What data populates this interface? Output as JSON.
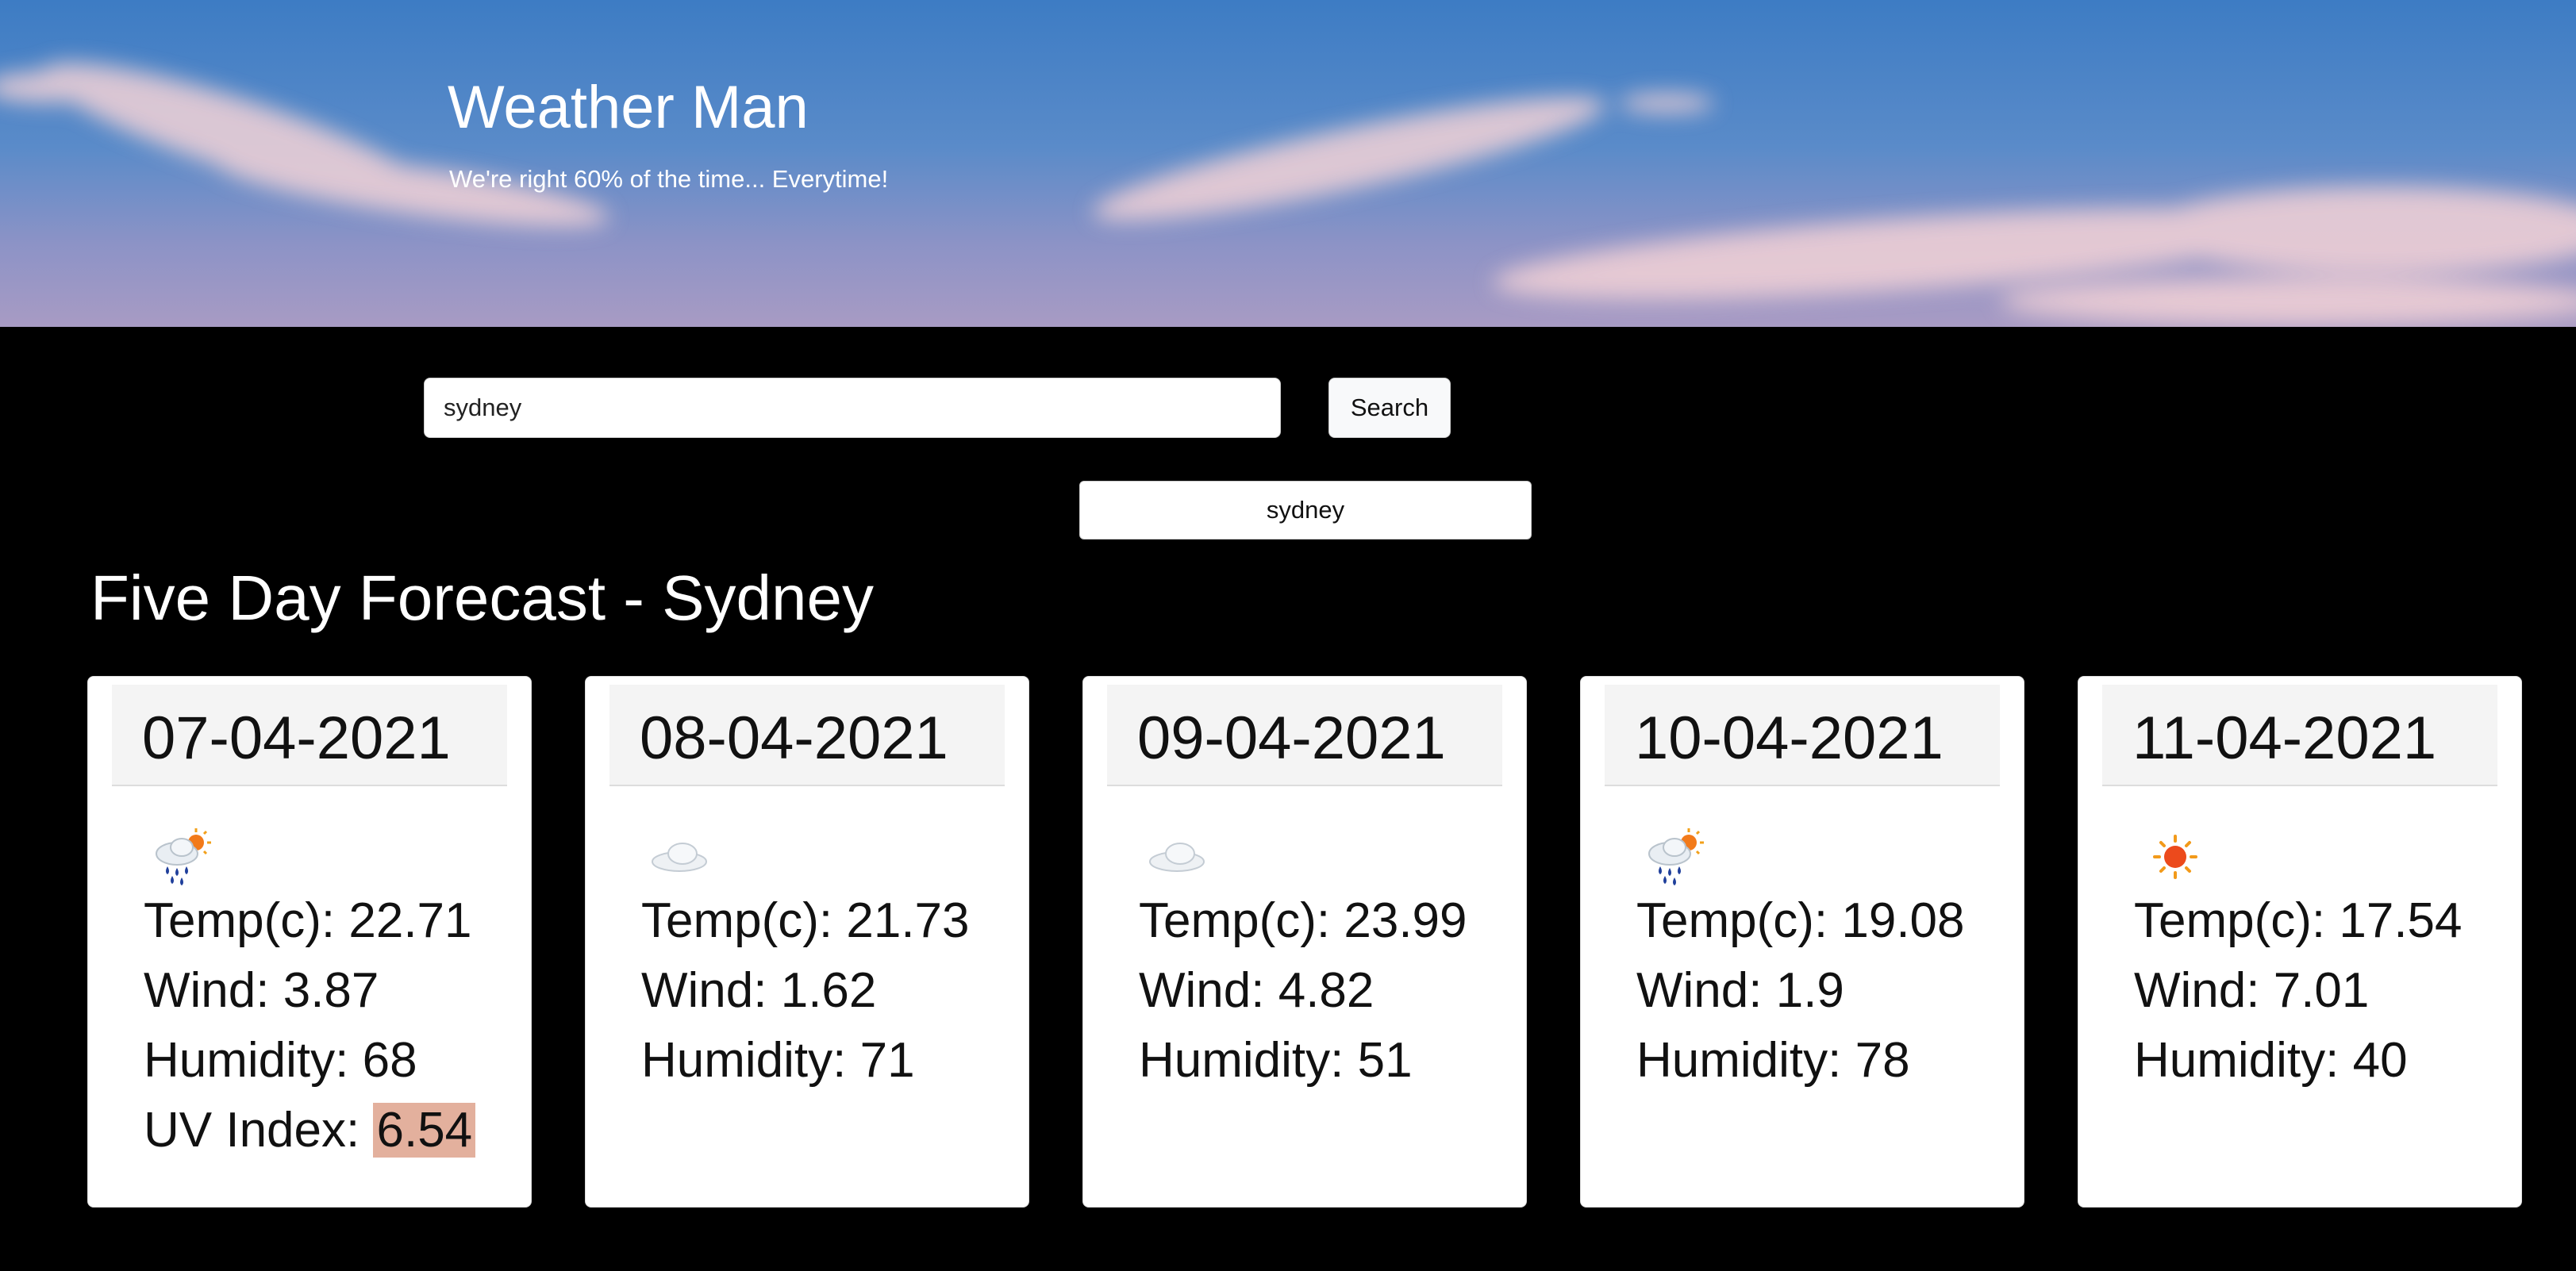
{
  "header": {
    "title": "Weather Man",
    "subtitle": "We're right 60% of the time... Everytime!"
  },
  "search": {
    "value": "sydney",
    "button_label": "Search"
  },
  "history": {
    "items": [
      "sydney"
    ]
  },
  "forecast": {
    "heading": "Five Day Forecast - Sydney",
    "days": [
      {
        "date": "07-04-2021",
        "icon": "rain-sun-icon",
        "temp": "Temp(c): 22.71",
        "wind": "Wind: 3.87",
        "humidity": "Humidity: 68",
        "uv_label": "UV Index: ",
        "uv_value": "6.54"
      },
      {
        "date": "08-04-2021",
        "icon": "cloud-icon",
        "temp": "Temp(c): 21.73",
        "wind": "Wind: 1.62",
        "humidity": "Humidity: 71"
      },
      {
        "date": "09-04-2021",
        "icon": "cloud-icon",
        "temp": "Temp(c): 23.99",
        "wind": "Wind: 4.82",
        "humidity": "Humidity: 51"
      },
      {
        "date": "10-04-2021",
        "icon": "rain-sun-icon",
        "temp": "Temp(c): 19.08",
        "wind": "Wind: 1.9",
        "humidity": "Humidity: 78"
      },
      {
        "date": "11-04-2021",
        "icon": "sun-icon",
        "temp": "Temp(c): 17.54",
        "wind": "Wind: 7.01",
        "humidity": "Humidity: 40"
      }
    ]
  },
  "colors": {
    "uv_highlight": "#e3b09d",
    "page_background": "#000000"
  }
}
